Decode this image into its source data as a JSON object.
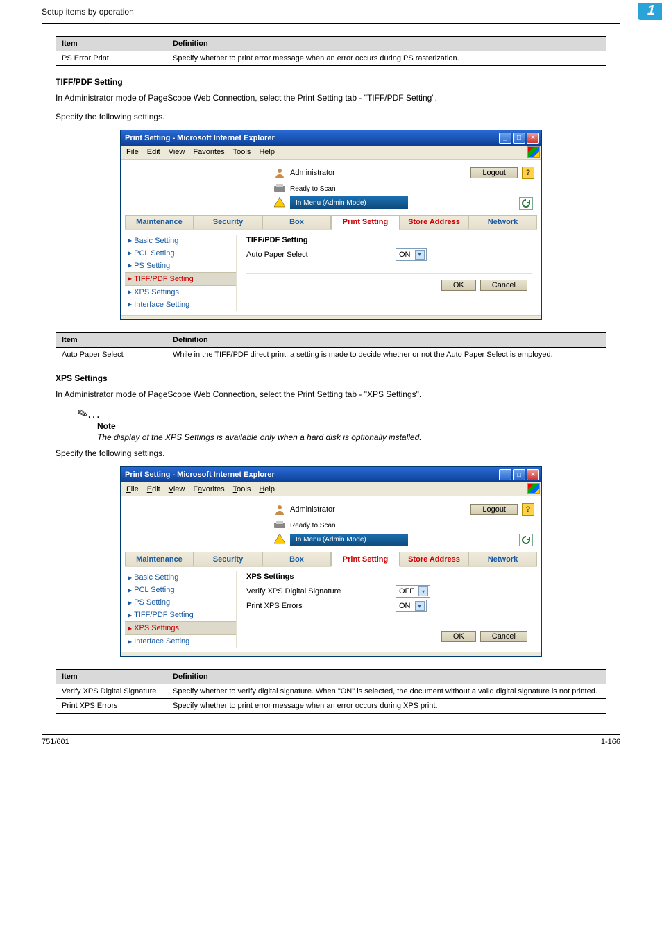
{
  "topbar": {
    "title": "Setup items by operation",
    "chapter": "1"
  },
  "table1": {
    "headers": {
      "item": "Item",
      "def": "Definition"
    },
    "rows": [
      {
        "item": "PS Error Print",
        "def": "Specify whether to print error message when an error occurs during PS rasterization."
      }
    ]
  },
  "section1": {
    "heading": "TIFF/PDF Setting",
    "para1": "In Administrator mode of PageScope Web Connection, select the Print Setting tab - \"TIFF/PDF Setting\".",
    "para2": "Specify the following settings."
  },
  "screenshot1": {
    "title": "Print Setting - Microsoft Internet Explorer",
    "menu": {
      "file": "File",
      "edit": "Edit",
      "view": "View",
      "favorites": "Favorites",
      "tools": "Tools",
      "help": "Help"
    },
    "admin_label": "Administrator",
    "logout": "Logout",
    "ready": "Ready to Scan",
    "mode": "In Menu (Admin Mode)",
    "tabs": {
      "maintenance": "Maintenance",
      "security": "Security",
      "box": "Box",
      "print": "Print Setting",
      "store": "Store Address",
      "network": "Network"
    },
    "sidebar": {
      "basic": "Basic Setting",
      "pcl": "PCL Setting",
      "ps": "PS Setting",
      "tiff": "TIFF/PDF Setting",
      "xps": "XPS Settings",
      "interface": "Interface Setting"
    },
    "panel": {
      "title": "TIFF/PDF Setting",
      "row1_label": "Auto Paper Select",
      "row1_value": "ON"
    },
    "buttons": {
      "ok": "OK",
      "cancel": "Cancel"
    }
  },
  "table2": {
    "headers": {
      "item": "Item",
      "def": "Definition"
    },
    "rows": [
      {
        "item": "Auto Paper Select",
        "def": "While in the TIFF/PDF direct print, a setting is made to decide whether or not the Auto Paper Select is employed."
      }
    ]
  },
  "section2": {
    "heading": "XPS Settings",
    "para1": "In Administrator mode of PageScope Web Connection, select the Print Setting tab - \"XPS Settings\"."
  },
  "note": {
    "label": "Note",
    "text": "The display of the XPS Settings is available only when a hard disk is optionally installed."
  },
  "section2b": {
    "para": "Specify the following settings."
  },
  "screenshot2": {
    "title": "Print Setting - Microsoft Internet Explorer",
    "panel": {
      "title": "XPS Settings",
      "row1_label": "Verify XPS Digital Signature",
      "row1_value": "OFF",
      "row2_label": "Print XPS Errors",
      "row2_value": "ON"
    }
  },
  "table3": {
    "headers": {
      "item": "Item",
      "def": "Definition"
    },
    "rows": [
      {
        "item": "Verify XPS Digital Signature",
        "def": "Specify whether to verify digital signature. When \"ON\" is selected, the document without a valid digital signature is not printed."
      },
      {
        "item": "Print XPS Errors",
        "def": "Specify whether to print error message when an error occurs during XPS print."
      }
    ]
  },
  "footer": {
    "left": "751/601",
    "right": "1-166"
  }
}
